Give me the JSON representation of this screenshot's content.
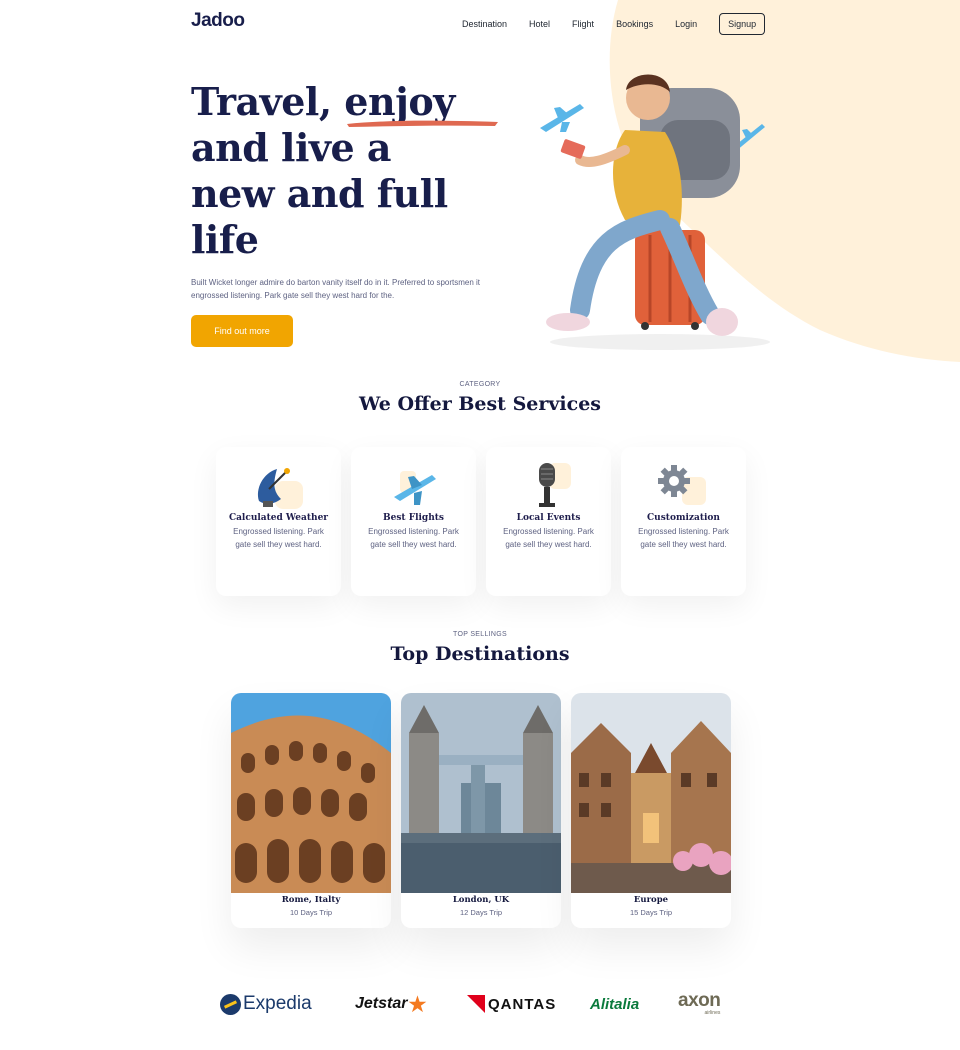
{
  "brand": {
    "logo": "Jadoo"
  },
  "nav": {
    "items": [
      "Destination",
      "Hotel",
      "Flight",
      "Bookings",
      "Login"
    ],
    "signup": "Signup"
  },
  "hero": {
    "title_lines": [
      "Travel, enjoy",
      "and live a",
      "new and full",
      "life"
    ],
    "description": "Built Wicket longer admire do barton vanity itself do in it. Preferred to sportsmen it engrossed listening. Park gate sell they west hard for the.",
    "cta": "Find out more"
  },
  "services": {
    "subtitle": "CATEGORY",
    "title": "We Offer Best Services",
    "items": [
      {
        "title": "Calculated Weather",
        "desc": "Engrossed listening. Park gate sell they west hard.",
        "icon": "satellite-dish-icon"
      },
      {
        "title": "Best Flights",
        "desc": "Engrossed listening. Park gate sell they west hard.",
        "icon": "airplane-icon"
      },
      {
        "title": "Local Events",
        "desc": "Engrossed listening. Park gate sell they west hard.",
        "icon": "microphone-icon"
      },
      {
        "title": "Customization",
        "desc": "Engrossed listening. Park gate sell they west hard.",
        "icon": "gear-icon"
      }
    ]
  },
  "destinations": {
    "subtitle": "TOP SELLINGS",
    "title": "Top Destinations",
    "items": [
      {
        "name": "Rome, Italty",
        "trip": "10 Days Trip"
      },
      {
        "name": "London, UK",
        "trip": "12 Days Trip"
      },
      {
        "name": "Europe",
        "trip": "15 Days Trip"
      }
    ]
  },
  "partners": {
    "expedia": "Expedia",
    "jetstar": "Jetstar",
    "qantas": "QANTAS",
    "alitalia": "Alitalia",
    "axon": "axon",
    "axon_sub": "airlines"
  },
  "colors": {
    "accent": "#F1A501",
    "navy": "#181E4B",
    "peach": "#FFF1DA",
    "underline": "#DF6951"
  }
}
